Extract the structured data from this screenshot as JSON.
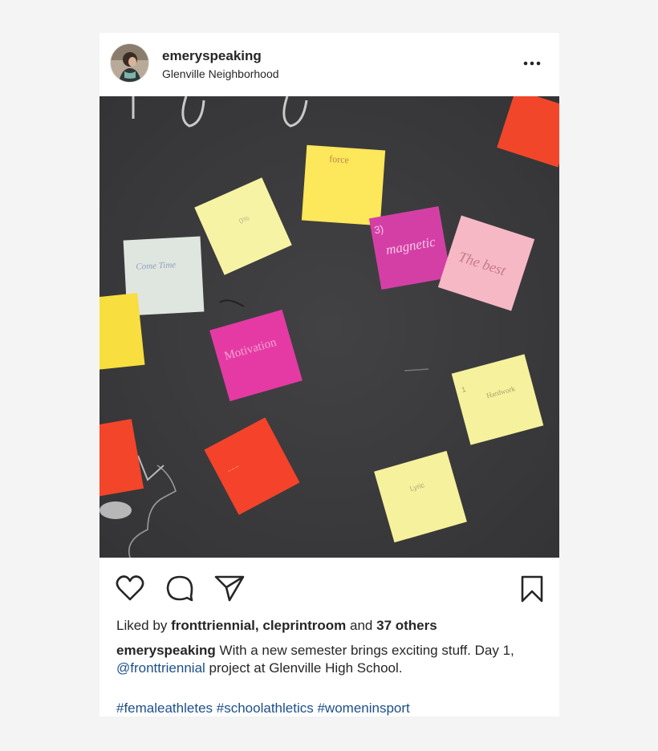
{
  "post": {
    "username": "emeryspeaking",
    "location": "Glenville Neighborhood",
    "more_icon": "more-horizontal-icon",
    "photo_notes": {
      "note_force": "force",
      "note_magnetic_num": "3)",
      "note_magnetic": "magnetic",
      "note_the_best": "The best",
      "note_come_time": "Come Time",
      "note_motivation": "Motivation",
      "note_lyrics": "Lyric",
      "note_hardwork": "Hardwork"
    },
    "actions": {
      "like_icon": "heart-icon",
      "comment_icon": "comment-icon",
      "share_icon": "send-icon",
      "save_icon": "bookmark-icon"
    },
    "likes": {
      "prefix": "Liked by",
      "user1": "fronttriennial,",
      "user2": "cleprintroom",
      "conj": "and",
      "others": "37 others"
    },
    "caption": {
      "author": "emeryspeaking",
      "text1": "With a new semester brings exciting stuff. Day 1,",
      "mention": "@fronttriennial",
      "text2": "project at Glenville High School."
    },
    "hashtags": [
      "#femaleathletes",
      "#schoolathletics",
      "#womeninsport"
    ]
  }
}
